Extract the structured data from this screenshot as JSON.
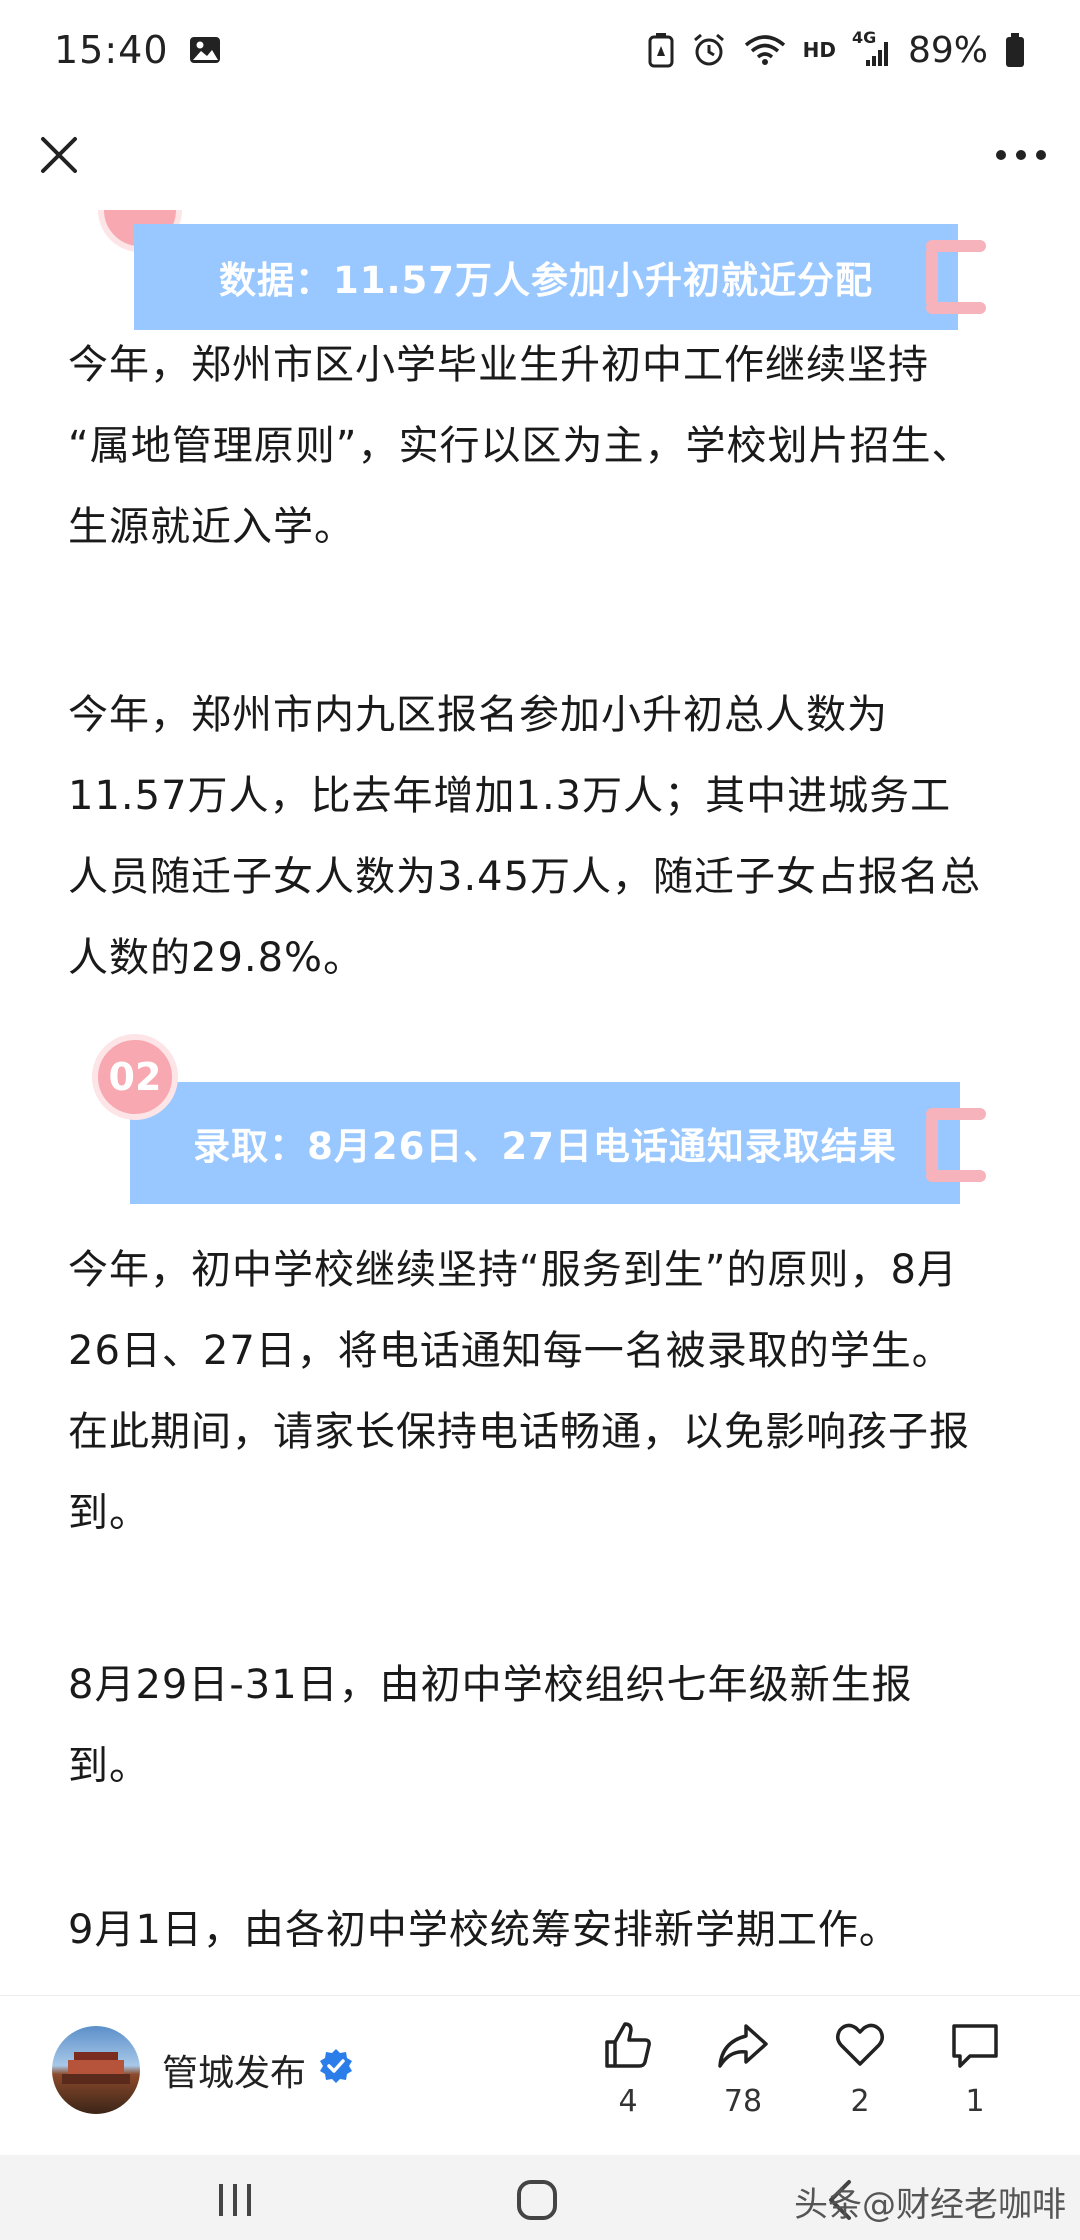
{
  "status_bar": {
    "time": "15:40",
    "hd": "HD",
    "network": "4G",
    "battery": "89%",
    "icons": [
      "gallery-icon",
      "battery-saver-icon",
      "alarm-icon",
      "wifi-icon",
      "signal-icon",
      "battery-icon"
    ]
  },
  "top_bar": {
    "close_icon": "close-icon",
    "more_icon": "more-icon"
  },
  "sections": [
    {
      "number": "",
      "title": "数据：11.57万人参加小升初就近分配"
    },
    {
      "number": "02",
      "title": "录取：8月26日、27日电话通知录取结果"
    }
  ],
  "paragraphs": [
    [
      "今年，郑州市区小学毕业生升初中工作继续坚持",
      "“属地管理原则”，实行以区为主，学校划片招生、",
      "生源就近入学。"
    ],
    [
      "今年，郑州市内九区报名参加小升初总人数为",
      "11.57万人，比去年增加1.3万人；其中进城务工",
      "人员随迁子女人数为3.45万人，随迁子女占报名总",
      "人数的29.8%。"
    ],
    [
      "今年，初中学校继续坚持“服务到生”的原则，8月",
      "26日、27日，将电话通知每一名被录取的学生。",
      "在此期间，请家长保持电话畅通，以免影响孩子报",
      "到。"
    ],
    [
      "8月29日-31日，由初中学校组织七年级新生报",
      "到。"
    ],
    [
      "9月1日，由各初中学校统筹安排新学期工作。"
    ]
  ],
  "footer": {
    "author": "管城发布",
    "verified_icon": "verified-badge-icon",
    "actions": [
      {
        "icon": "thumbs-up-icon",
        "count": "4"
      },
      {
        "icon": "share-icon",
        "count": "78"
      },
      {
        "icon": "heart-icon",
        "count": "2"
      },
      {
        "icon": "comment-icon",
        "count": "1"
      }
    ]
  },
  "nav_bar": {
    "icons": [
      "recent-apps-icon",
      "home-icon",
      "back-icon"
    ],
    "watermark": "头条@财经老咖啡"
  },
  "colors": {
    "banner": "#99c7ff",
    "accent_pink": "#f7a8b0",
    "verified_blue": "#2b7de9"
  }
}
